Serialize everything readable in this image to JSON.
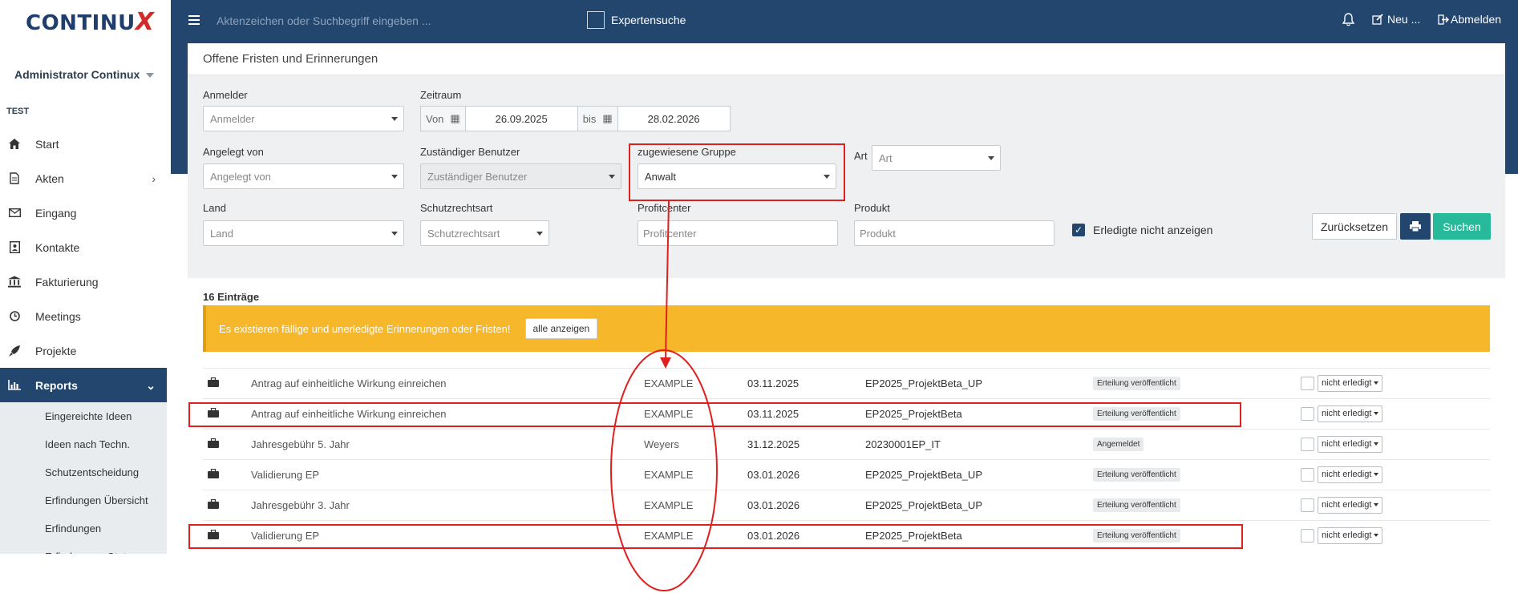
{
  "app": {
    "logo_main": "CONTINU",
    "logo_x": "X"
  },
  "sidebar": {
    "user": "Administrator Continux",
    "section": "TEST",
    "items": [
      {
        "label": "Start",
        "icon": "home-icon"
      },
      {
        "label": "Akten",
        "icon": "file-icon"
      },
      {
        "label": "Eingang",
        "icon": "envelope-icon"
      },
      {
        "label": "Kontakte",
        "icon": "contact-card-icon"
      },
      {
        "label": "Fakturierung",
        "icon": "bank-icon"
      },
      {
        "label": "Meetings",
        "icon": "clock-icon"
      },
      {
        "label": "Projekte",
        "icon": "rocket-icon"
      },
      {
        "label": "Reports",
        "icon": "bar-chart-icon"
      }
    ],
    "subitems": [
      "Eingereichte Ideen",
      "Ideen nach Techn.",
      "Schutzentscheidung",
      "Erfindungen Übersicht",
      "Erfindungen",
      "Erfinderverg. Status"
    ]
  },
  "topbar": {
    "search_placeholder": "Aktenzeichen oder Suchbegriff eingeben ...",
    "expert_label": "Expertensuche",
    "new_label": "Neu ...",
    "logout_label": "Abmelden"
  },
  "filters": {
    "title": "Offene Fristen und Erinnerungen",
    "anmelder_label": "Anmelder",
    "anmelder_placeholder": "Anmelder",
    "zeitraum_label": "Zeitraum",
    "von_label": "Von",
    "von_value": "26.09.2025",
    "bis_label": "bis",
    "bis_value": "28.02.2026",
    "angelegt_label": "Angelegt von",
    "angelegt_placeholder": "Angelegt von",
    "zust_label": "Zuständiger Benutzer",
    "zust_placeholder": "Zuständiger Benutzer",
    "gruppe_label": "zugewiesene Gruppe",
    "gruppe_value": "Anwalt",
    "art_label": "Art",
    "art_placeholder": "Art",
    "land_label": "Land",
    "land_placeholder": "Land",
    "schutz_label": "Schutzrechtsart",
    "schutz_placeholder": "Schutzrechtsart",
    "profit_label": "Profitcenter",
    "profit_placeholder": "Profitcenter",
    "produkt_label": "Produkt",
    "produkt_placeholder": "Produkt",
    "hide_done_label": "Erledigte nicht anzeigen",
    "reset_label": "Zurücksetzen",
    "search_label": "Suchen"
  },
  "results": {
    "count_label": "16 Einträge",
    "alert_text": "Es existieren fällige und unerledigte Erinnerungen oder Fristen!",
    "show_all_label": "alle anzeigen",
    "rows": [
      {
        "title": "Antrag auf einheitliche Wirkung einreichen",
        "who": "EXAMPLE",
        "date": "03.11.2025",
        "ref": "EP2025_ProjektBeta_UP",
        "badge": "Erteilung veröffentlicht",
        "status": "nicht erledigt"
      },
      {
        "title": "Antrag auf einheitliche Wirkung einreichen",
        "who": "EXAMPLE",
        "date": "03.11.2025",
        "ref": "EP2025_ProjektBeta",
        "badge": "Erteilung veröffentlicht",
        "status": "nicht erledigt"
      },
      {
        "title": "Jahresgebühr 5. Jahr",
        "who": "Weyers",
        "date": "31.12.2025",
        "ref": "20230001EP_IT",
        "badge": "Angemeldet",
        "status": "nicht erledigt"
      },
      {
        "title": "Validierung EP",
        "who": "EXAMPLE",
        "date": "03.01.2026",
        "ref": "EP2025_ProjektBeta_UP",
        "badge": "Erteilung veröffentlicht",
        "status": "nicht erledigt"
      },
      {
        "title": "Jahresgebühr 3. Jahr",
        "who": "EXAMPLE",
        "date": "03.01.2026",
        "ref": "EP2025_ProjektBeta_UP",
        "badge": "Erteilung veröffentlicht",
        "status": "nicht erledigt"
      },
      {
        "title": "Validierung EP",
        "who": "EXAMPLE",
        "date": "03.01.2026",
        "ref": "EP2025_ProjektBeta",
        "badge": "Erteilung veröffentlicht",
        "status": "nicht erledigt"
      }
    ]
  },
  "colors": {
    "primary": "#23466e",
    "success": "#26b99a",
    "warning": "#f6b82a",
    "annotation": "#e01f1f"
  }
}
